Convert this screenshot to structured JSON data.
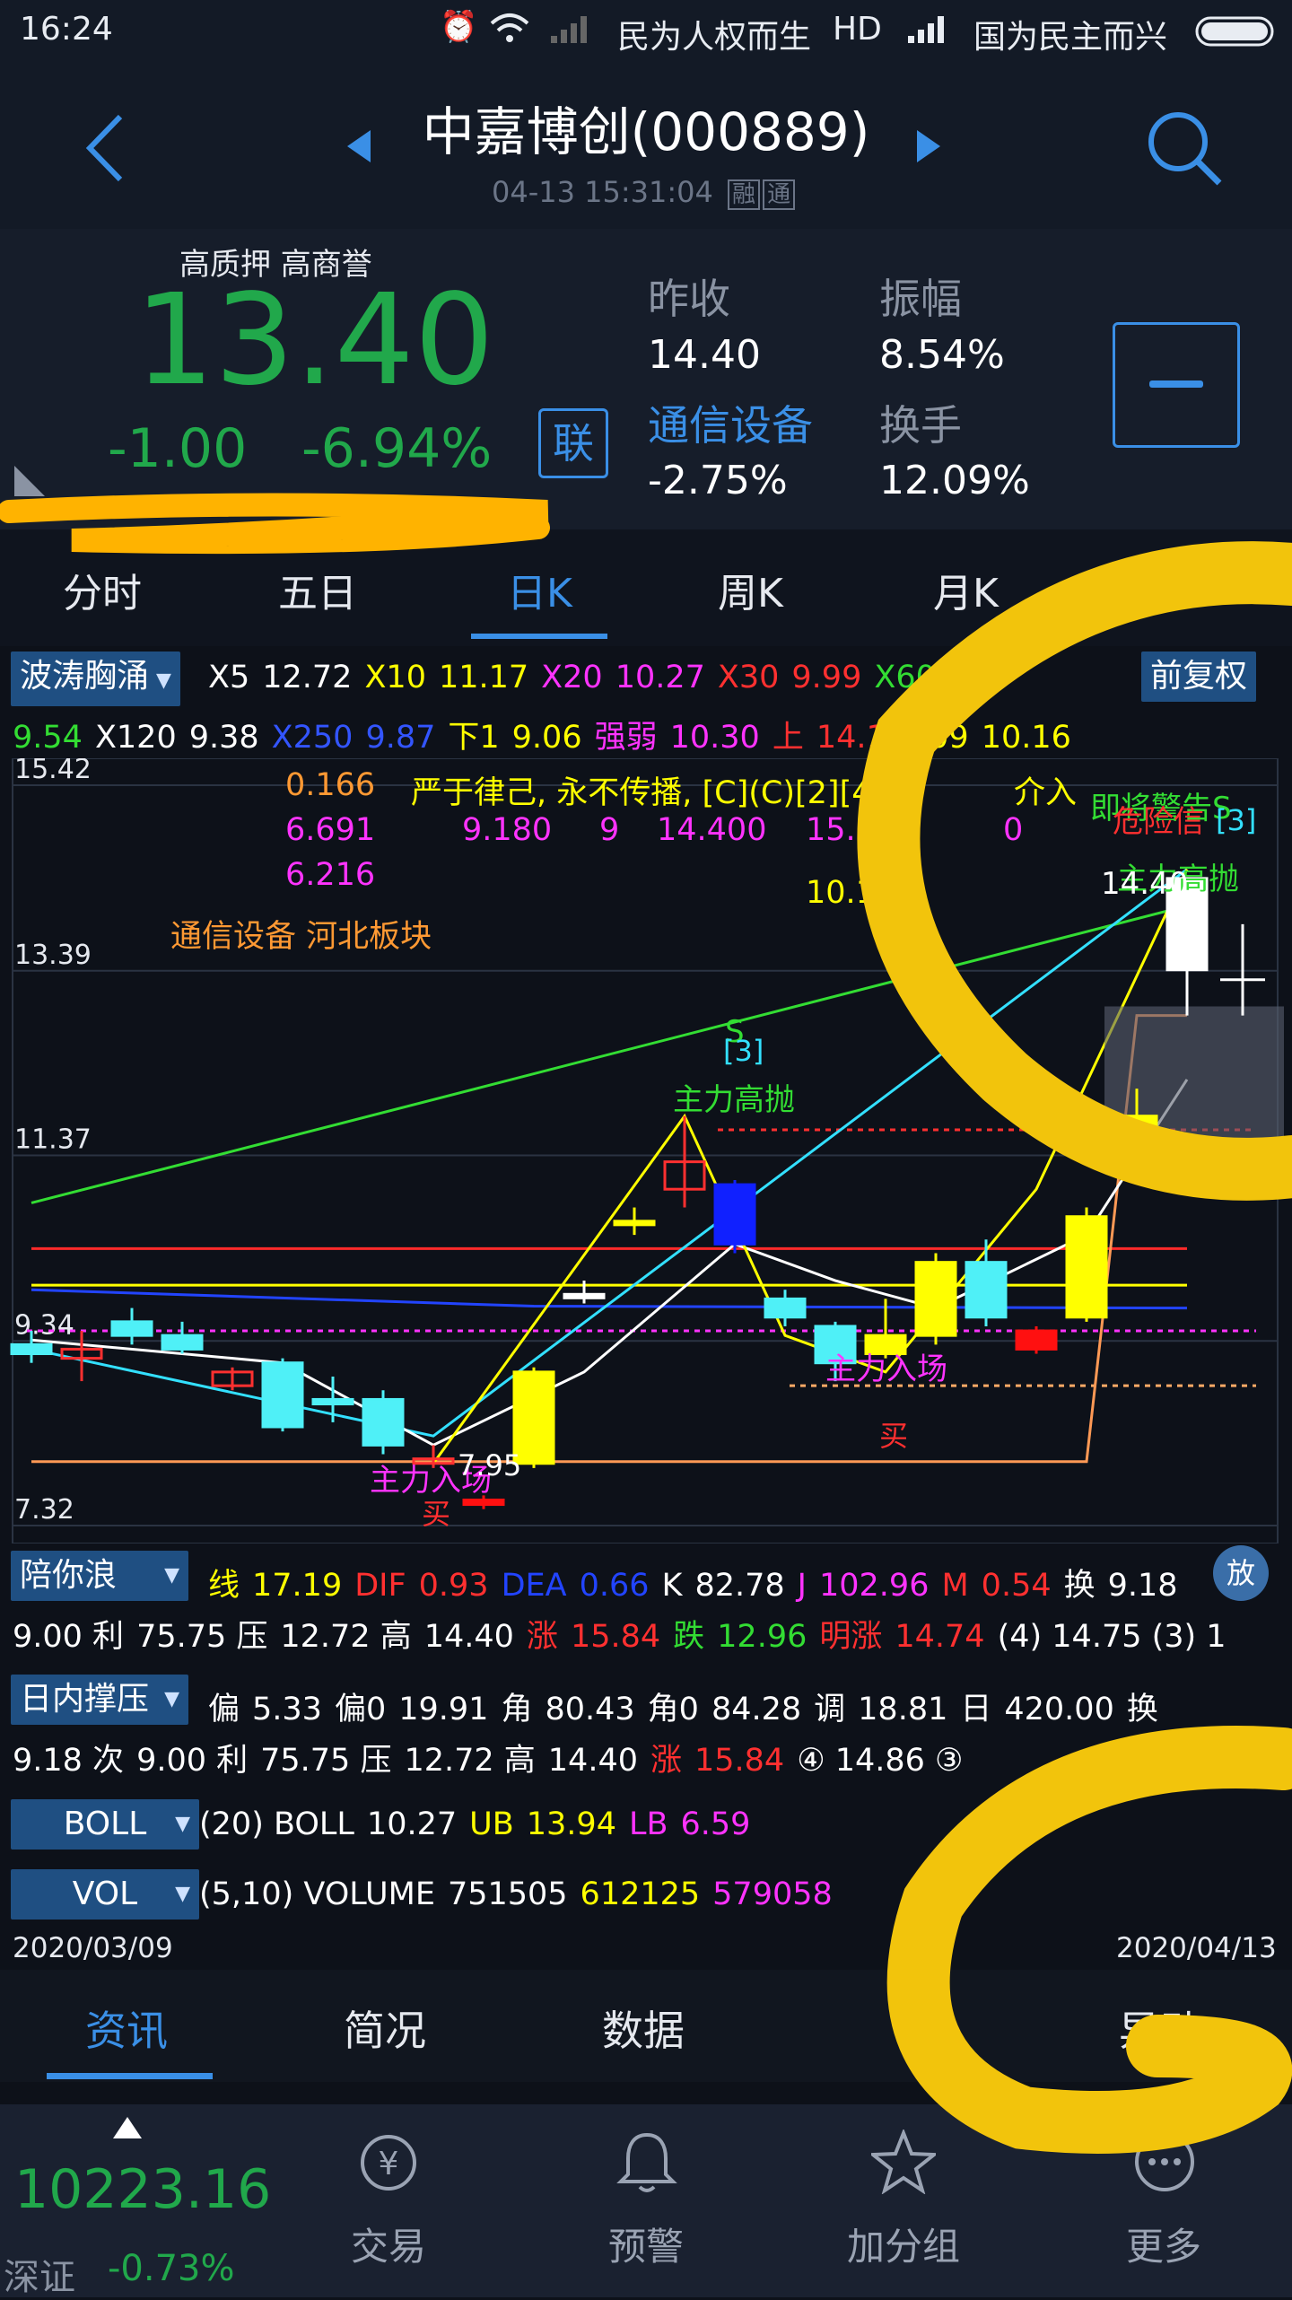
{
  "status_bar": {
    "time": "16:24",
    "carrier1": "民为人权而生",
    "hd": "HD",
    "carrier2": "国为民主而兴"
  },
  "header": {
    "title": "中嘉博创(000889)",
    "datetime": "04-13 15:31:04",
    "badge1": "融",
    "badge2": "通",
    "back_icon": "back-arrow-icon",
    "search_icon": "search-icon"
  },
  "quote": {
    "tags": "高质押 高商誉",
    "price": "13.40",
    "change": "-1.00",
    "change_pct": "-6.94%",
    "link_label": "联",
    "prev_close_label": "昨收",
    "prev_close": "14.40",
    "amplitude_label": "振幅",
    "amplitude": "8.54%",
    "sector_label": "通信设备",
    "sector_change": "-2.75%",
    "turnover_label": "换手",
    "turnover": "12.09%",
    "collapse_label": "—",
    "down_color": "#21a84b",
    "up_color": "#e8282a"
  },
  "ktabs": [
    "分时",
    "五日",
    "日K",
    "周K",
    "月K"
  ],
  "ktab_active": 2,
  "ma_bar": {
    "selector": "波涛胸涌",
    "adjust": "前复权",
    "line1": [
      {
        "t": "X5",
        "c": "#ffffff"
      },
      {
        "t": "12.72",
        "c": "#ffffff"
      },
      {
        "t": "X10",
        "c": "#ffff00"
      },
      {
        "t": "11.17",
        "c": "#ffff00"
      },
      {
        "t": "X20",
        "c": "#ff33ff"
      },
      {
        "t": "10.27",
        "c": "#ff33ff"
      },
      {
        "t": "X30",
        "c": "#ff3030"
      },
      {
        "t": "9.99",
        "c": "#ff3030"
      },
      {
        "t": "X60",
        "c": "#33dd33"
      }
    ],
    "line2": [
      {
        "t": "9.54",
        "c": "#33dd33"
      },
      {
        "t": "X120",
        "c": "#ffffff"
      },
      {
        "t": "9.38",
        "c": "#ffffff"
      },
      {
        "t": "X250",
        "c": "#3355ff"
      },
      {
        "t": "9.87",
        "c": "#3355ff"
      },
      {
        "t": "下1",
        "c": "#ffff00"
      },
      {
        "t": "9.06",
        "c": "#ffff00"
      },
      {
        "t": "强弱",
        "c": "#ff33ff"
      },
      {
        "t": "10.30",
        "c": "#ff33ff"
      },
      {
        "t": "上",
        "c": "#ff3030"
      },
      {
        "t": "14.19",
        "c": "#ff3030"
      },
      {
        "t": ".09",
        "c": "#ffff00"
      },
      {
        "t": "10.16",
        "c": "#ffff00"
      }
    ]
  },
  "chart_data": {
    "type": "candlestick",
    "y_axis_labels": [
      "15.42",
      "13.39",
      "11.37",
      "9.34",
      "7.32"
    ],
    "ylim": [
      7.32,
      15.42
    ],
    "x_range": [
      "2020/03/09",
      "2020/04/13"
    ],
    "overlay_text": {
      "line1": [
        "0.166",
        "严于律己, 永不传播, [C](C)[2][4",
        "介入"
      ],
      "line2": [
        "6.691",
        "9.180",
        "9",
        "14.400",
        "15.84",
        "0"
      ],
      "line3": "6.216",
      "sector": "通信设备 河北板块",
      "partial": "10.1",
      "warn1": "即将警告S",
      "warn2": "危险信",
      "warn3": "[3]",
      "high_sell_right": "主力高抛",
      "high_label": "14.40",
      "high_sell_mid": "主力高抛",
      "s_mark": "S",
      "bracket3": "[3]",
      "enter1": "主力入场",
      "enter2": "主力入场",
      "low_label": "7.95",
      "buy1": "买",
      "buy2": "买"
    },
    "candles": [
      {
        "o": 9.2,
        "c": 9.3,
        "h": 9.45,
        "l": 9.1,
        "color": "cyan"
      },
      {
        "o": 9.25,
        "c": 9.15,
        "h": 9.45,
        "l": 8.9,
        "color": "red"
      },
      {
        "o": 9.4,
        "c": 9.55,
        "h": 9.7,
        "l": 9.3,
        "color": "cyan"
      },
      {
        "o": 9.4,
        "c": 9.25,
        "h": 9.55,
        "l": 9.2,
        "color": "cyan"
      },
      {
        "o": 9.0,
        "c": 8.85,
        "h": 9.05,
        "l": 8.8,
        "color": "red"
      },
      {
        "o": 9.1,
        "c": 8.4,
        "h": 9.15,
        "l": 8.35,
        "color": "cyan"
      },
      {
        "o": 8.7,
        "c": 8.65,
        "h": 8.95,
        "l": 8.45,
        "color": "cyan"
      },
      {
        "o": 8.7,
        "c": 8.2,
        "h": 8.8,
        "l": 8.1,
        "color": "cyan"
      },
      {
        "o": 8.05,
        "c": 8.0,
        "h": 8.2,
        "l": 7.95,
        "color": "red"
      },
      {
        "o": 7.6,
        "c": 7.55,
        "h": 7.65,
        "l": 7.5,
        "color": "redfill"
      },
      {
        "o": 8.0,
        "c": 9.0,
        "h": 9.05,
        "l": 7.95,
        "color": "yellow"
      },
      {
        "o": 9.85,
        "c": 9.85,
        "h": 10.0,
        "l": 9.75,
        "color": "white"
      },
      {
        "o": 10.65,
        "c": 10.65,
        "h": 10.8,
        "l": 10.5,
        "color": "yellow"
      },
      {
        "o": 11.3,
        "c": 11.0,
        "h": 11.8,
        "l": 10.8,
        "color": "red"
      },
      {
        "o": 11.05,
        "c": 10.4,
        "h": 11.1,
        "l": 10.3,
        "color": "blue"
      },
      {
        "o": 9.8,
        "c": 9.6,
        "h": 9.9,
        "l": 9.5,
        "color": "cyan"
      },
      {
        "o": 9.5,
        "c": 9.1,
        "h": 9.55,
        "l": 8.9,
        "color": "cyan"
      },
      {
        "o": 9.2,
        "c": 9.4,
        "h": 9.8,
        "l": 9.15,
        "color": "yellow"
      },
      {
        "o": 9.4,
        "c": 10.2,
        "h": 10.3,
        "l": 9.3,
        "color": "yellow"
      },
      {
        "o": 9.6,
        "c": 10.2,
        "h": 10.45,
        "l": 9.5,
        "color": "cyan"
      },
      {
        "o": 9.25,
        "c": 9.45,
        "h": 9.5,
        "l": 9.2,
        "color": "redfill"
      },
      {
        "o": 9.6,
        "c": 10.7,
        "h": 10.8,
        "l": 9.55,
        "color": "yellow"
      },
      {
        "o": 11.7,
        "c": 11.8,
        "h": 12.1,
        "l": 11.6,
        "color": "yellow"
      },
      {
        "o": 14.4,
        "c": 13.4,
        "h": 14.4,
        "l": 12.9,
        "color": "white"
      }
    ],
    "lines": [
      {
        "name": "green-trend",
        "color": "#33dd33",
        "points": [
          [
            0,
            10.85
          ],
          [
            23,
            14.1
          ]
        ]
      },
      {
        "name": "red-support",
        "color": "#ff2a2a",
        "points": [
          [
            0,
            10.35
          ],
          [
            23,
            10.35
          ]
        ]
      },
      {
        "name": "yellow-hline",
        "color": "#ffff00",
        "points": [
          [
            0,
            9.95
          ],
          [
            23,
            9.95
          ]
        ]
      },
      {
        "name": "blue-ma",
        "color": "#2244ff",
        "points": [
          [
            0,
            9.9
          ],
          [
            10,
            9.72
          ],
          [
            23,
            9.7
          ]
        ]
      },
      {
        "name": "orange-floor",
        "color": "#ff9955",
        "points": [
          [
            0,
            8.02
          ],
          [
            21,
            8.02
          ],
          [
            22,
            12.9
          ],
          [
            23,
            12.9
          ]
        ]
      },
      {
        "name": "cyan-trend",
        "color": "#33e0ff",
        "points": [
          [
            0,
            9.25
          ],
          [
            8,
            8.3
          ],
          [
            23,
            14.5
          ]
        ]
      },
      {
        "name": "white-ma",
        "color": "#ffffff",
        "points": [
          [
            0,
            9.35
          ],
          [
            5,
            9.1
          ],
          [
            8,
            8.2
          ],
          [
            11,
            9.0
          ],
          [
            14,
            10.4
          ],
          [
            16,
            10.0
          ],
          [
            18,
            9.7
          ],
          [
            21,
            10.5
          ],
          [
            23,
            12.2
          ]
        ]
      },
      {
        "name": "yellow-zigzag",
        "color": "#ffff00",
        "points": [
          [
            8,
            8.0
          ],
          [
            13,
            11.8
          ],
          [
            15,
            9.4
          ],
          [
            17,
            9.0
          ],
          [
            20,
            11.0
          ],
          [
            23,
            14.5
          ]
        ]
      }
    ]
  },
  "macd_row": {
    "selector": "陪你浪",
    "items": [
      {
        "t": "线",
        "c": "#ffff00"
      },
      {
        "t": "17.19",
        "c": "#ffff00"
      },
      {
        "t": "DIF",
        "c": "#ff3030"
      },
      {
        "t": "0.93",
        "c": "#ff3030"
      },
      {
        "t": "DEA",
        "c": "#2244ff"
      },
      {
        "t": "0.66",
        "c": "#2244ff"
      },
      {
        "t": "K",
        "c": "#ffffff"
      },
      {
        "t": "82.78",
        "c": "#ffffff"
      },
      {
        "t": "J",
        "c": "#ff33ff"
      },
      {
        "t": "102.96",
        "c": "#ff33ff"
      },
      {
        "t": "M",
        "c": "#ff3030"
      },
      {
        "t": "0.54",
        "c": "#ff3030"
      },
      {
        "t": "换",
        "c": "#ffffff"
      },
      {
        "t": "9.18",
        "c": "#ffffff"
      }
    ],
    "line2": [
      {
        "t": "9.00 利",
        "c": "#ffffff"
      },
      {
        "t": "75.75 压",
        "c": "#ffffff"
      },
      {
        "t": "12.72 高",
        "c": "#ffffff"
      },
      {
        "t": "14.40",
        "c": "#ffffff"
      },
      {
        "t": "涨",
        "c": "#ff3030"
      },
      {
        "t": "15.84",
        "c": "#ff3030"
      },
      {
        "t": "跌",
        "c": "#33dd33"
      },
      {
        "t": "12.96",
        "c": "#33dd33"
      },
      {
        "t": "明涨",
        "c": "#ff3030"
      },
      {
        "t": "14.74",
        "c": "#ff3030"
      },
      {
        "t": "(4) 14.75 (3) 1",
        "c": "#ffffff"
      }
    ]
  },
  "intraday_row": {
    "selector": "日内撑压",
    "items": [
      {
        "t": "偏",
        "c": "#ffffff"
      },
      {
        "t": "5.33",
        "c": "#ffffff"
      },
      {
        "t": "偏0",
        "c": "#ffffff"
      },
      {
        "t": "19.91",
        "c": "#ffffff"
      },
      {
        "t": "角",
        "c": "#ffffff"
      },
      {
        "t": "80.43",
        "c": "#ffffff"
      },
      {
        "t": "角0",
        "c": "#ffffff"
      },
      {
        "t": "84.28",
        "c": "#ffffff"
      },
      {
        "t": "调",
        "c": "#ffffff"
      },
      {
        "t": "18.81",
        "c": "#ffffff"
      },
      {
        "t": "日",
        "c": "#ffffff"
      },
      {
        "t": "420.00",
        "c": "#ffffff"
      },
      {
        "t": "换",
        "c": "#ffffff"
      }
    ],
    "line2": [
      {
        "t": "9.18 次",
        "c": "#ffffff"
      },
      {
        "t": "9.00 利",
        "c": "#ffffff"
      },
      {
        "t": "75.75 压",
        "c": "#ffffff"
      },
      {
        "t": "12.72 高",
        "c": "#ffffff"
      },
      {
        "t": "14.40",
        "c": "#ffffff"
      },
      {
        "t": "涨",
        "c": "#ff3030"
      },
      {
        "t": "15.84",
        "c": "#ff3030"
      },
      {
        "t": "④ 14.86 ③",
        "c": "#ffffff"
      }
    ]
  },
  "boll_row": {
    "selector": "BOLL",
    "items": [
      {
        "t": "(20) BOLL",
        "c": "#ffffff"
      },
      {
        "t": "10.27",
        "c": "#ffffff"
      },
      {
        "t": "UB",
        "c": "#ffff00"
      },
      {
        "t": "13.94",
        "c": "#ffff00"
      },
      {
        "t": "LB",
        "c": "#ff33ff"
      },
      {
        "t": "6.59",
        "c": "#ff33ff"
      }
    ]
  },
  "vol_row": {
    "selector": "VOL",
    "items": [
      {
        "t": "(5,10) VOLUME",
        "c": "#ffffff"
      },
      {
        "t": "751505",
        "c": "#ffffff"
      },
      {
        "t": "612125",
        "c": "#ffff00"
      },
      {
        "t": "579058",
        "c": "#ff33ff"
      }
    ]
  },
  "date_range": {
    "start": "2020/03/09",
    "end": "2020/04/13"
  },
  "bottom_tabs": [
    "资讯",
    "简况",
    "数据",
    "",
    "异动"
  ],
  "bottom_tabs_partial": "D",
  "bottom_tab_active": 0,
  "nav": {
    "index_value": "10223.16",
    "index_name": "深证",
    "index_change": "-0.73%",
    "items": [
      {
        "label": "交易",
        "icon": "yen-icon"
      },
      {
        "label": "预警",
        "icon": "bell-icon"
      },
      {
        "label": "加分组",
        "icon": "star-icon"
      },
      {
        "label": "更多",
        "icon": "more-icon"
      }
    ]
  },
  "zoom_label": "放"
}
